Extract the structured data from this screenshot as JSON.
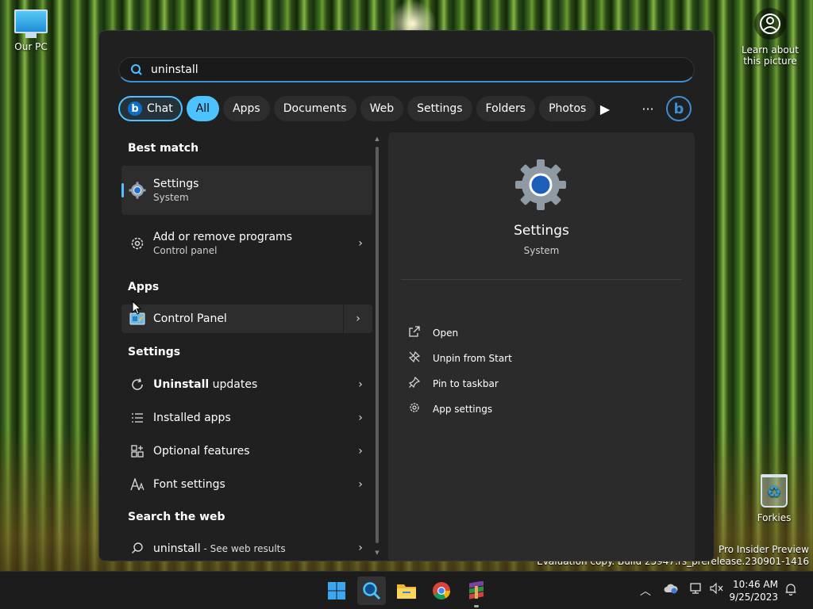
{
  "desktop": {
    "our_pc_label": "Our PC",
    "recycle_label": "Forkies",
    "learn_label_line1": "Learn about",
    "learn_label_line2": "this picture",
    "watermark_line1": "s 11 Pro Insider Preview",
    "watermark_line2": "Evaluation copy. Build 25947.rs_prerelease.230901-1416"
  },
  "search": {
    "query": "uninstall",
    "filters": [
      "Chat",
      "All",
      "Apps",
      "Documents",
      "Web",
      "Settings",
      "Folders",
      "Photos"
    ],
    "active_filter": "All"
  },
  "results": {
    "best_match_header": "Best match",
    "best_match": {
      "title": "Settings",
      "subtitle": "System"
    },
    "add_remove": {
      "title": "Add or remove programs",
      "subtitle": "Control panel"
    },
    "apps_header": "Apps",
    "control_panel": {
      "title": "Control Panel"
    },
    "settings_header": "Settings",
    "settings_items": {
      "uninstall_bold": "Uninstall",
      "uninstall_rest": " updates",
      "installed_apps": "Installed apps",
      "optional_features": "Optional features",
      "font_settings": "Font settings"
    },
    "web_header": "Search the web",
    "web_item": {
      "query": "uninstall",
      "suffix": " - See web results"
    }
  },
  "preview": {
    "title": "Settings",
    "subtitle": "System",
    "actions": {
      "open": "Open",
      "unpin": "Unpin from Start",
      "pin_taskbar": "Pin to taskbar",
      "app_settings": "App settings"
    }
  },
  "taskbar": {
    "time": "10:46 AM",
    "date": "9/25/2023"
  },
  "colors": {
    "accent": "#4cc2ff",
    "panel_bg": "#202020",
    "preview_bg": "#2b2b2b"
  }
}
